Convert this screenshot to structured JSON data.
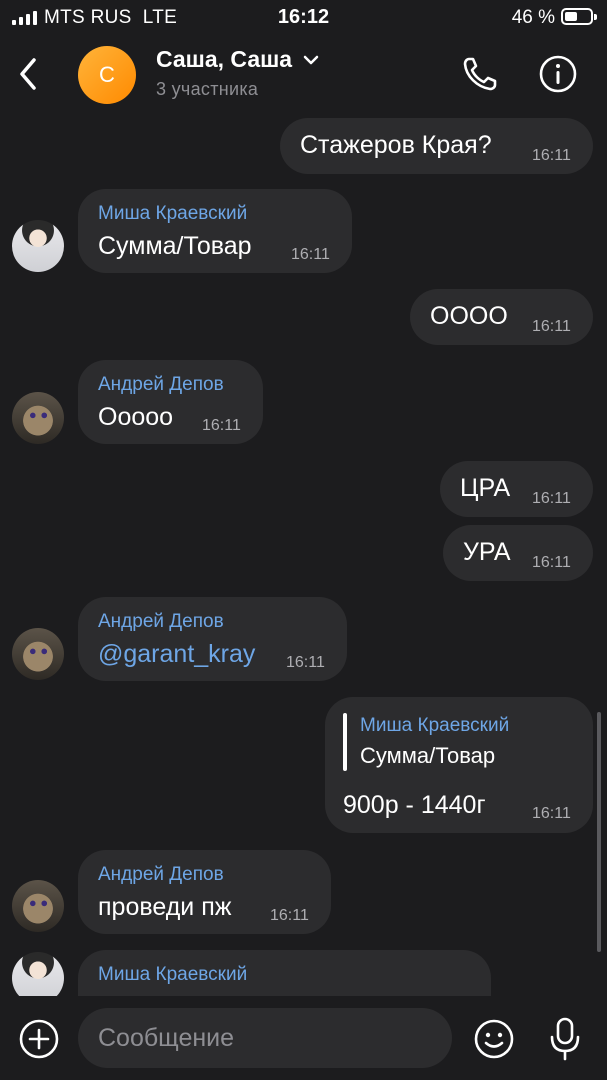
{
  "status_bar": {
    "carrier": "MTS RUS",
    "network": "LTE",
    "time": "16:12",
    "battery": "46 %"
  },
  "header": {
    "avatar_letter": "С",
    "title": "Саша, Саша",
    "subtitle": "3 участника"
  },
  "messages": [
    {
      "dir": "out",
      "text": "Стажеров Края?",
      "time": "16:11"
    },
    {
      "dir": "in",
      "sender": "Миша Краевский",
      "text": "Сумма/Товар",
      "time": "16:11"
    },
    {
      "dir": "out",
      "text": "ОООО",
      "time": "16:11"
    },
    {
      "dir": "in",
      "sender": "Андрей Депов",
      "text": "Ооооо",
      "time": "16:11"
    },
    {
      "dir": "out",
      "text": "ЦРА",
      "time": "16:11"
    },
    {
      "dir": "out",
      "text": "УРА",
      "time": "16:11"
    },
    {
      "dir": "in",
      "sender": "Андрей Депов",
      "text": "@garant_kray",
      "time": "16:11"
    },
    {
      "dir": "out",
      "quote_sender": "Миша Краевский",
      "quote_text": "Сумма/Товар",
      "text": "900р - 1440г",
      "time": "16:11"
    },
    {
      "dir": "in",
      "sender": "Андрей Депов",
      "text": "проведи пж",
      "time": "16:11"
    },
    {
      "dir": "in",
      "sender": "Миша Краевский"
    }
  ],
  "composer": {
    "placeholder": "Сообщение"
  },
  "icons": {
    "back": "chevron-left-icon",
    "dropdown": "chevron-down-icon",
    "call": "phone-icon",
    "info": "info-icon",
    "attach": "plus-circle-icon",
    "emoji": "smiley-icon",
    "mic": "microphone-icon"
  },
  "colors": {
    "background": "#1c1c1e",
    "bubble": "#2c2c2e",
    "sender": "#6ea6e6",
    "accent": "#ff9500",
    "muted": "#8e8e93"
  }
}
